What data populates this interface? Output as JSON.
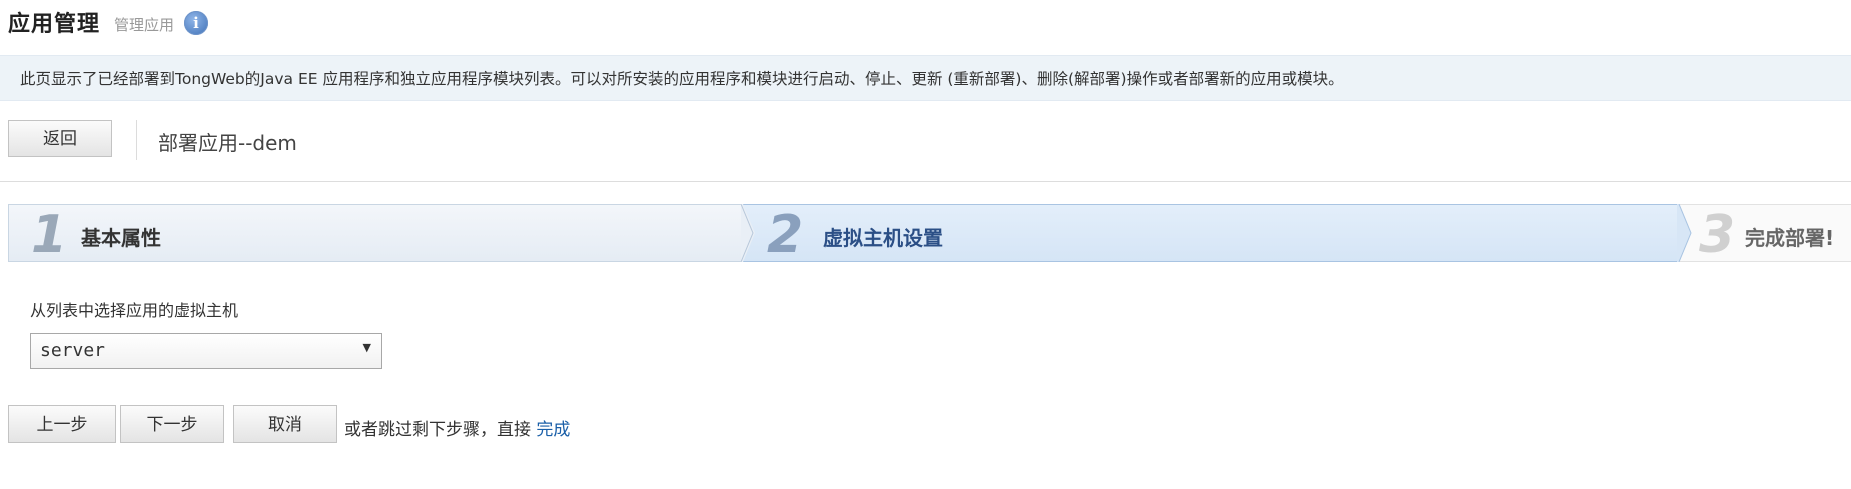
{
  "header": {
    "title": "应用管理",
    "subtitle": "管理应用",
    "info_icon": "i"
  },
  "info_bar": {
    "text": "此页显示了已经部署到TongWeb的Java EE 应用程序和独立应用程序模块列表。可以对所安装的应用程序和模块进行启动、停止、更新 (重新部署)、删除(解部署)操作或者部署新的应用或模块。"
  },
  "toolbar": {
    "back_label": "返回",
    "deploy_title": "部署应用--dem"
  },
  "wizard": {
    "steps": [
      {
        "number": "1",
        "label": "基本属性",
        "state": "done"
      },
      {
        "number": "2",
        "label": "虚拟主机设置",
        "state": "active"
      },
      {
        "number": "3",
        "label": "完成部署!",
        "state": "pending"
      }
    ]
  },
  "form": {
    "virtual_host_label": "从列表中选择应用的虚拟主机",
    "virtual_host_value": "server"
  },
  "actions": {
    "prev_label": "上一步",
    "next_label": "下一步",
    "cancel_label": "取消",
    "skip_text": "或者跳过剩下步骤，直接",
    "finish_link": "完成"
  },
  "colors": {
    "accent": "#2b4f86",
    "info_bar_bg": "#edf3f8",
    "active_step_bg": "#d5e5f6",
    "link": "#1a5fa8"
  }
}
